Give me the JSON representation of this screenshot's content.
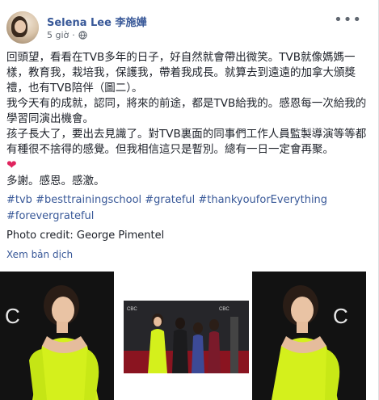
{
  "post": {
    "author": "Selena Lee 李施嬅",
    "time": "5 giờ",
    "privacy_icon": "globe-icon",
    "more_icon": "more-options-icon",
    "paragraphs": [
      "回頭望，看看在TVB多年的日子，好自然就會帶出微笑。TVB就像媽媽一樣，教育我，栽培我，保護我，帶着我成長。就算去到遠遠的加拿大頒獎禮，也有TVB陪伴（圖二）。",
      "我今天有的成就，認同，將來的前途，都是TVB給我的。感恩每一次給我的學習同演出機會。",
      "孩子長大了，要出去見識了。對TVB裏面的同事們工作人員監製導演等等都有種很不捨得的感覺。但我相信這只是暫別。總有一日一定會再聚。",
      "多謝。感恩。感激。"
    ],
    "heart_icon": "red-heart-icon",
    "hashtags": [
      "#tvb",
      "#besttrainingschool",
      "#grateful",
      "#thankyouforEverything",
      "#forevergrateful"
    ],
    "credit": "Photo credit: George Pimentel",
    "translate_label": "Xem bản dịch"
  },
  "photos": {
    "logo_text_left": "C",
    "logo_text_right": "C",
    "event_logo": "CBC"
  },
  "colors": {
    "link": "#385898",
    "text": "#1d2129",
    "meta": "#606770",
    "dress": "#d4f01c",
    "heart": "#e0245e"
  }
}
